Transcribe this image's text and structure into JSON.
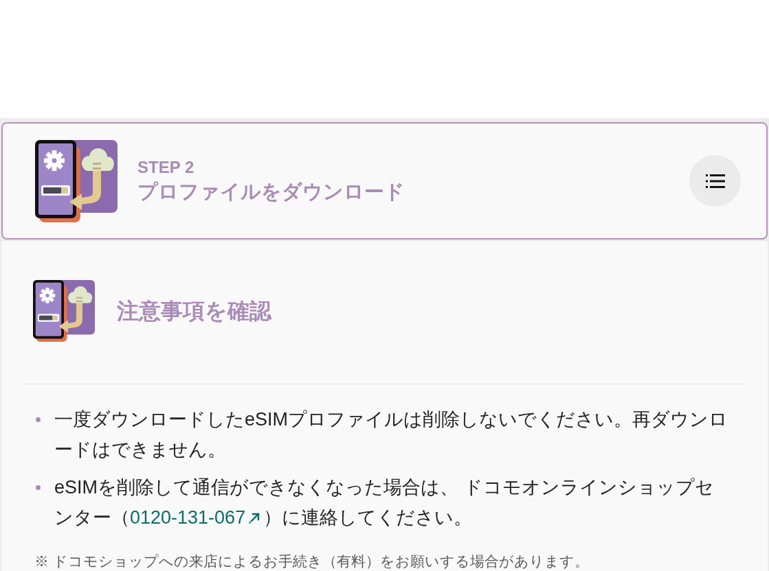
{
  "header": {
    "step": "STEP 2",
    "title": "プロファイルをダウンロード"
  },
  "section": {
    "heading": "注意事項を確認",
    "items": [
      {
        "kind": "text",
        "text": "一度ダウンロードしたeSIMプロファイルは削除しないでください。再ダウンロードはできません。"
      },
      {
        "kind": "link",
        "text": "eSIMを削除して通信ができなくなった場合は、 ドコモオンラインショップセンター（",
        "link": "0120-131-067",
        "text_after": "）に連絡してください。"
      }
    ],
    "note": "※ ドコモショップへの来店によるお手続き（有料）をお願いする場合があります。"
  }
}
